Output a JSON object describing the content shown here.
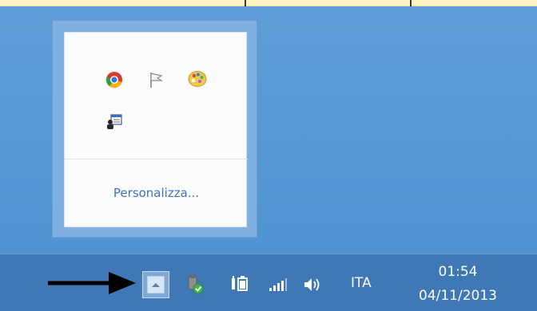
{
  "overflow_panel": {
    "customize_label": "Personalizza...",
    "icons": [
      {
        "name": "chrome-icon"
      },
      {
        "name": "flag-icon"
      },
      {
        "name": "paint-palette-icon"
      },
      {
        "name": "user-window-icon"
      }
    ]
  },
  "taskbar": {
    "show_hidden_icons": "show-hidden-icons-arrow",
    "tray_icons": [
      {
        "name": "update-shield-icon"
      },
      {
        "name": "battery-icon"
      },
      {
        "name": "signal-bars-icon"
      },
      {
        "name": "speaker-icon"
      }
    ],
    "language": "ITA",
    "clock": {
      "time": "01:54",
      "date": "04/11/2013"
    }
  },
  "colors": {
    "desktop": "#5a9bd5",
    "taskbar": "#3f78b5",
    "link": "#3a73c4"
  }
}
